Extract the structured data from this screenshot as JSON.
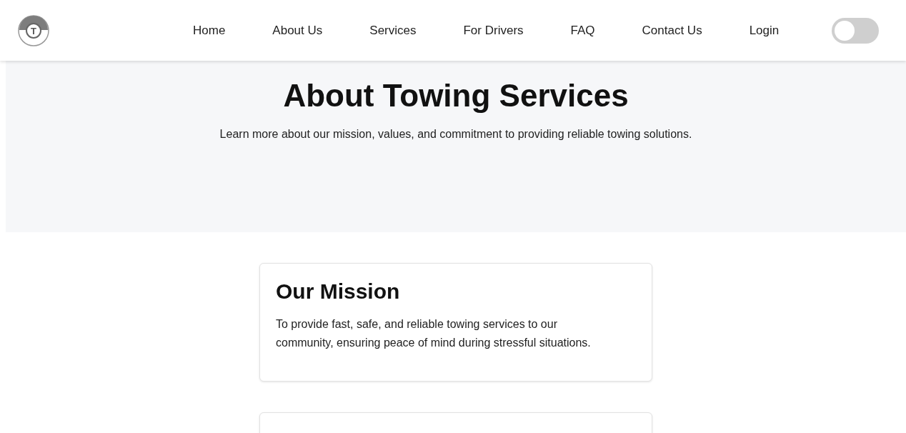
{
  "logo": {
    "letter": "T"
  },
  "nav": [
    {
      "label": "Home"
    },
    {
      "label": "About Us"
    },
    {
      "label": "Services"
    },
    {
      "label": "For Drivers"
    },
    {
      "label": "FAQ"
    },
    {
      "label": "Contact Us"
    },
    {
      "label": "Login"
    }
  ],
  "theme_toggle": {
    "on": false
  },
  "hero": {
    "title": "About Towing Services",
    "subtitle": "Learn more about our mission, values, and commitment to providing reliable towing solutions."
  },
  "cards": [
    {
      "kind": "full",
      "title": "Our Mission",
      "text": "To provide fast, safe, and reliable towing services to our community, ensuring peace of mind during stressful situations."
    },
    {
      "kind": "cut_off"
    }
  ]
}
